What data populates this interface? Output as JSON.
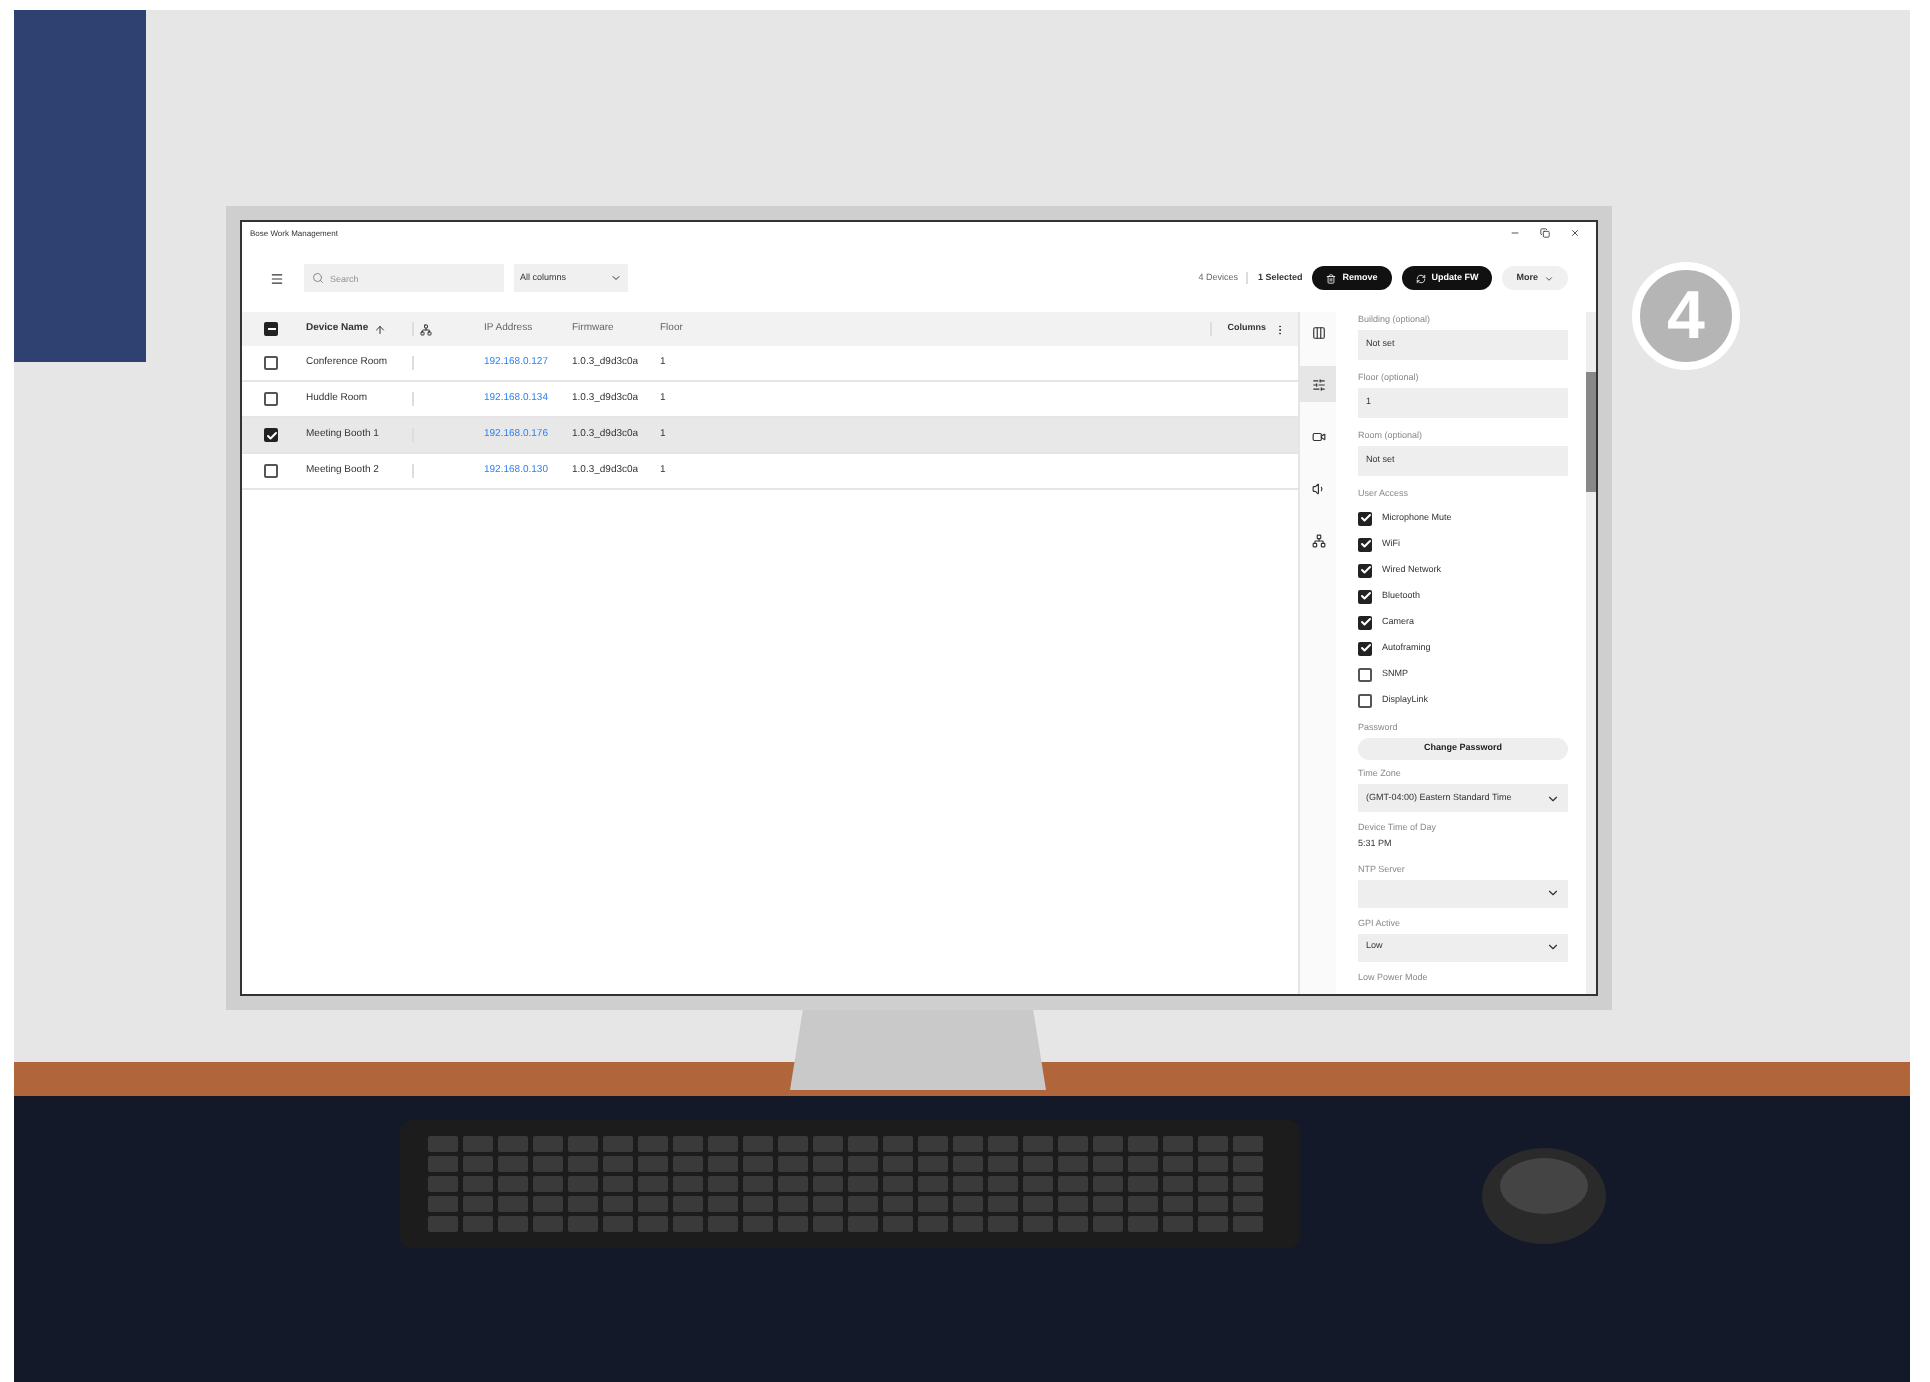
{
  "window": {
    "title": "Bose Work Management"
  },
  "toolbar": {
    "search_placeholder": "Search",
    "filter": "All columns",
    "device_count": "4 Devices",
    "selected_count": "1 Selected",
    "buttons": [
      {
        "label": "Remove",
        "kind": "remove"
      },
      {
        "label": "Update FW",
        "kind": "update"
      },
      {
        "label": "More",
        "kind": "more"
      }
    ]
  },
  "table": {
    "header_indeterminate": true,
    "columns_button": "Columns",
    "columns": [
      {
        "kind": "text",
        "label": "Device Name",
        "sorted": true
      },
      {
        "kind": "icon"
      },
      {
        "kind": "text",
        "label": "IP Address",
        "sorted": false
      },
      {
        "kind": "text",
        "label": "Firmware",
        "sorted": false
      },
      {
        "kind": "text",
        "label": "Floor",
        "sorted": false
      }
    ],
    "rows": [
      {
        "name": "Conference Room",
        "ip": "192.168.0.127",
        "firmware": "1.0.3_d9d3c0a",
        "floor": "1",
        "selected": false
      },
      {
        "name": "Huddle Room",
        "ip": "192.168.0.134",
        "firmware": "1.0.3_d9d3c0a",
        "floor": "1",
        "selected": false
      },
      {
        "name": "Meeting Booth 1",
        "ip": "192.168.0.176",
        "firmware": "1.0.3_d9d3c0a",
        "floor": "1",
        "selected": true
      },
      {
        "name": "Meeting Booth 2",
        "ip": "192.168.0.130",
        "firmware": "1.0.3_d9d3c0a",
        "floor": "1",
        "selected": false
      }
    ]
  },
  "rail": [
    {
      "kind": "columns",
      "selected": false
    },
    {
      "kind": "settings",
      "selected": true
    },
    {
      "kind": "camera",
      "selected": false
    },
    {
      "kind": "audio",
      "selected": false
    },
    {
      "kind": "network",
      "selected": false
    }
  ],
  "panel": [
    {
      "kind": "field",
      "label": "Building (optional)",
      "value": "Not set"
    },
    {
      "kind": "field",
      "label": "Floor (optional)",
      "value": "1"
    },
    {
      "kind": "field",
      "label": "Room (optional)",
      "value": "Not set"
    },
    {
      "kind": "checks",
      "label": "User Access",
      "options": [
        {
          "label": "Microphone Mute",
          "checked": true
        },
        {
          "label": "WiFi",
          "checked": true
        },
        {
          "label": "Wired Network",
          "checked": true
        },
        {
          "label": "Bluetooth",
          "checked": true
        },
        {
          "label": "Camera",
          "checked": true
        },
        {
          "label": "Autoframing",
          "checked": true
        },
        {
          "label": "SNMP",
          "checked": false
        },
        {
          "label": "DisplayLink",
          "checked": false
        }
      ]
    },
    {
      "kind": "button",
      "label": "Password",
      "button": "Change Password"
    },
    {
      "kind": "select",
      "label": "Time Zone",
      "value": "(GMT-04:00) Eastern Standard Time"
    },
    {
      "kind": "readonly",
      "label": "Device Time of Day",
      "value": "5:31 PM"
    },
    {
      "kind": "select",
      "label": "NTP Server"
    },
    {
      "kind": "select",
      "label": "GPI Active",
      "value": "Low"
    },
    {
      "kind": "heading",
      "label": "Low Power Mode"
    }
  ],
  "step_badge": "4"
}
